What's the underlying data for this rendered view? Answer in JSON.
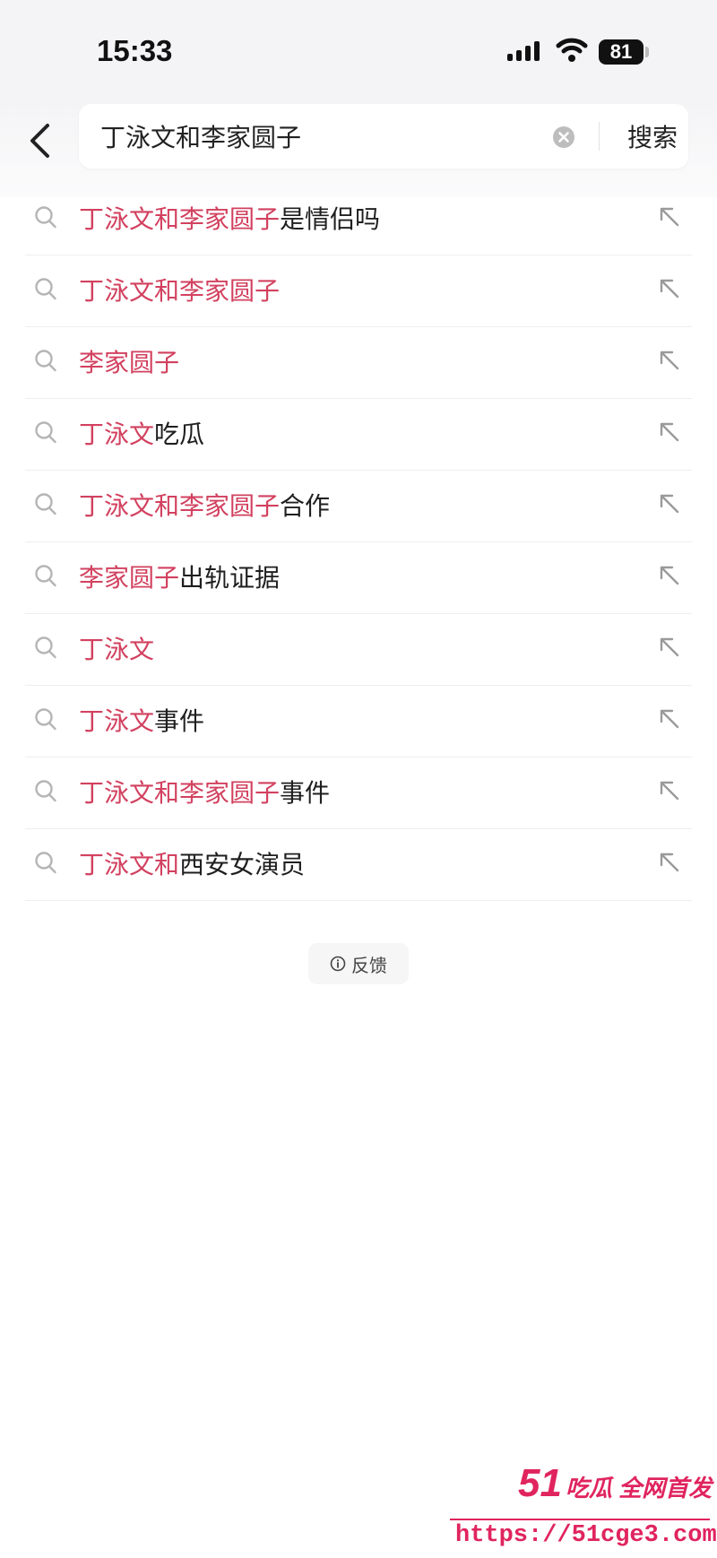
{
  "status_bar": {
    "time": "15:33",
    "battery": "81"
  },
  "search": {
    "query": "丁泳文和李家圆子",
    "button_label": "搜索"
  },
  "suggestions": [
    {
      "highlight": "丁泳文和李家圆子",
      "rest": "是情侣吗"
    },
    {
      "highlight": "丁泳文和李家圆子",
      "rest": ""
    },
    {
      "highlight": "李家圆子",
      "rest": ""
    },
    {
      "highlight": "丁泳文",
      "rest": "吃瓜"
    },
    {
      "highlight": "丁泳文和李家圆子",
      "rest": "合作"
    },
    {
      "highlight": "李家圆子",
      "rest": "出轨证据"
    },
    {
      "highlight": "丁泳文",
      "rest": ""
    },
    {
      "highlight": "丁泳文",
      "rest": "事件"
    },
    {
      "highlight": "丁泳文和李家圆子",
      "rest": "事件"
    },
    {
      "highlight": "丁泳文和",
      "rest": "西安女演员"
    }
  ],
  "feedback": {
    "label": "反馈"
  },
  "watermark": {
    "brand_number": "51",
    "brand_text": "吃瓜 全网首发",
    "url": "https://51cge3.com"
  },
  "colors": {
    "highlight": "#d2415f",
    "watermark": "#e0245e",
    "header_bg": "#f4f4f6"
  },
  "icons": {
    "suggestion_leading": "search-icon",
    "suggestion_trailing": "fill-arrow-icon"
  }
}
